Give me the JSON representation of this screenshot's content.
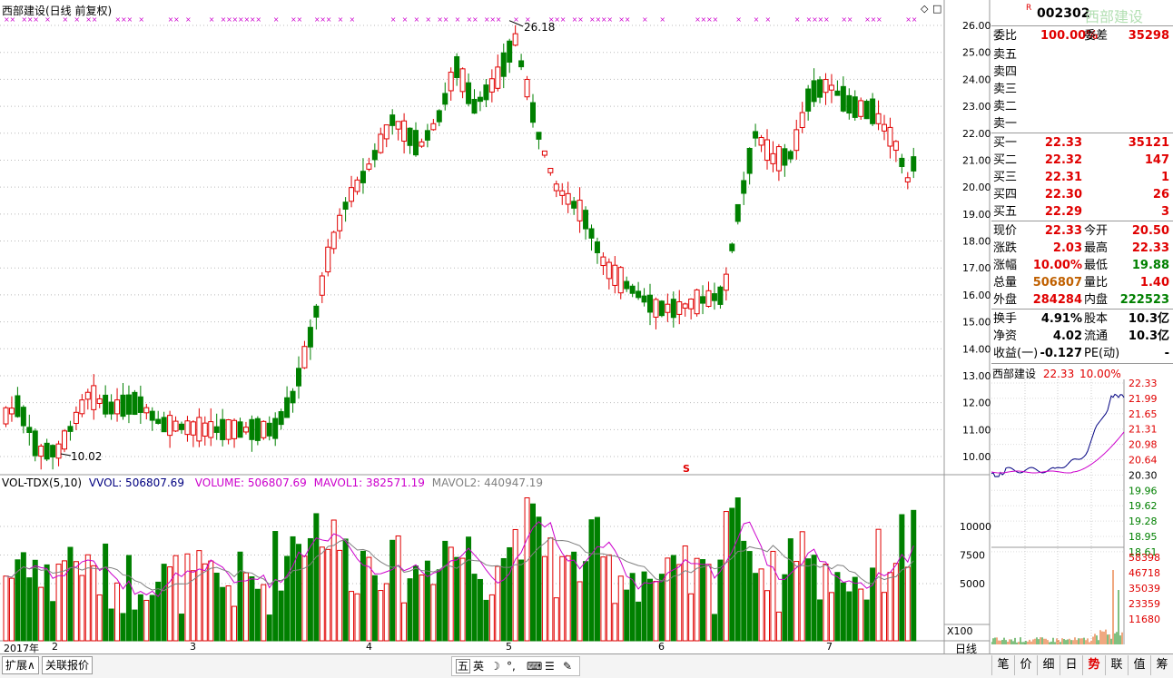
{
  "stock": {
    "name": "西部建设",
    "code": "002302",
    "rtag": "R",
    "title": "西部建设(日线 前复权)"
  },
  "chart": {
    "price_axis": [
      "26.00",
      "25.00",
      "24.00",
      "23.00",
      "22.00",
      "21.00",
      "20.00",
      "19.00",
      "18.00",
      "17.00",
      "16.00",
      "15.00",
      "14.00",
      "13.00",
      "12.00",
      "11.00",
      "10.00"
    ],
    "vol_axis": [
      "10000",
      "7500",
      "5000"
    ],
    "vol_unit": "X100",
    "high_label": "26.18",
    "low_label": "10.02",
    "s_marker": "S",
    "indicator": {
      "name": "VOL-TDX(5,10)",
      "vvol": "VVOL: 506807.69",
      "volume": "VOLUME: 506807.69",
      "mavol1": "MAVOL1: 382571.19",
      "mavol2": "MAVOL2: 440947.19"
    },
    "months": [
      "2017年",
      "2",
      "3",
      "4",
      "5",
      "6",
      "7"
    ],
    "period": "日线",
    "colors": {
      "up": "#e00000",
      "down": "#008000",
      "ma1": "#cc00cc",
      "ma2": "#808080"
    }
  },
  "quote": {
    "weibi_label": "委比",
    "weibi": "100.00%",
    "weicha_label": "委差",
    "weicha": "35298",
    "sell": [
      {
        "label": "卖五"
      },
      {
        "label": "卖四"
      },
      {
        "label": "卖三"
      },
      {
        "label": "卖二"
      },
      {
        "label": "卖一"
      }
    ],
    "buy": [
      {
        "label": "买一",
        "price": "22.33",
        "vol": "35121"
      },
      {
        "label": "买二",
        "price": "22.32",
        "vol": "147"
      },
      {
        "label": "买三",
        "price": "22.31",
        "vol": "1"
      },
      {
        "label": "买四",
        "price": "22.30",
        "vol": "26"
      },
      {
        "label": "买五",
        "price": "22.29",
        "vol": "3"
      }
    ],
    "stats": [
      {
        "l1": "现价",
        "v1": "22.33",
        "l2": "今开",
        "v2": "20.50"
      },
      {
        "l1": "涨跌",
        "v1": "2.03",
        "l2": "最高",
        "v2": "22.33"
      },
      {
        "l1": "涨幅",
        "v1": "10.00%",
        "l2": "最低",
        "v2": "19.88"
      },
      {
        "l1": "总量",
        "v1": "506807",
        "l2": "量比",
        "v2": "1.40"
      },
      {
        "l1": "外盘",
        "v1": "284284",
        "l2": "内盘",
        "v2": "222523"
      }
    ],
    "fund": [
      {
        "l1": "换手",
        "v1": "4.91%",
        "l2": "股本",
        "v2": "10.3亿"
      },
      {
        "l1": "净资",
        "v1": "4.02",
        "l2": "流通",
        "v2": "10.3亿"
      },
      {
        "l1": "收益(一)",
        "v1": "-0.127",
        "l2": "PE(动)",
        "v2": "-"
      }
    ]
  },
  "mini": {
    "name": "西部建设",
    "price": "22.33",
    "pct": "10.00%",
    "price_labels": [
      "22.33",
      "21.99",
      "21.65",
      "21.31",
      "20.98",
      "20.64",
      "20.30",
      "19.96",
      "19.62",
      "19.28",
      "18.95",
      "18.61"
    ],
    "vol_labels": [
      "58398",
      "46718",
      "35039",
      "23359",
      "11680"
    ]
  },
  "tabs": [
    "扩展∧",
    "关联报价"
  ],
  "right_tabs": [
    "笔",
    "价",
    "细",
    "日",
    "势",
    "联",
    "值",
    "筹"
  ],
  "toolbar": [
    "五",
    "英"
  ]
}
